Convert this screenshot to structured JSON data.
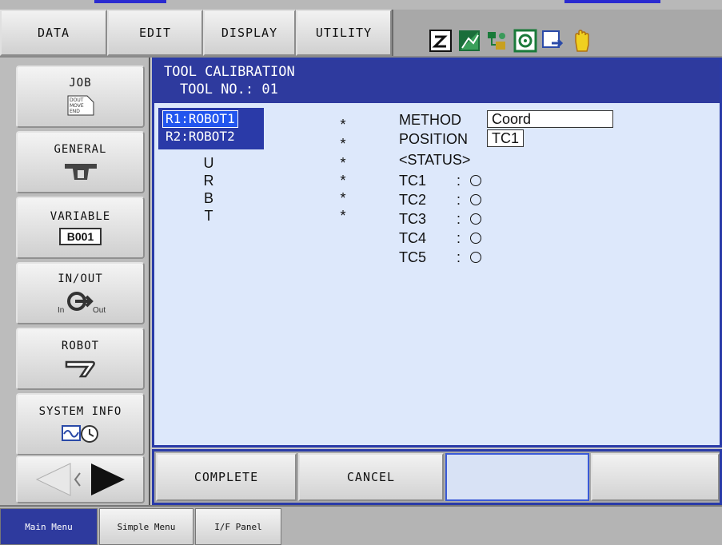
{
  "menu": {
    "data": "DATA",
    "edit": "EDIT",
    "display": "DISPLAY",
    "utility": "UTILITY"
  },
  "status_icons": [
    "mode-icon",
    "signal-icon",
    "network-icon",
    "target-icon",
    "export-icon",
    "hand-icon"
  ],
  "sidebar": {
    "job": "JOB",
    "job_icon_text": [
      "DOUT",
      "MOVE",
      "END"
    ],
    "general": "GENERAL",
    "variable": "VARIABLE",
    "variable_tag": "B001",
    "inout": "IN/OUT",
    "inout_in": "In",
    "inout_out": "Out",
    "robot": "ROBOT",
    "system_info": "SYSTEM INFO"
  },
  "panel": {
    "title": "TOOL CALIBRATION",
    "tool_no": "TOOL NO.: 01",
    "robots": [
      "R1:ROBOT1",
      "R2:ROBOT2"
    ],
    "axes": [
      "U",
      "R",
      "B",
      "T"
    ],
    "stars": [
      "*",
      "*",
      "*",
      "*",
      "*",
      "*"
    ],
    "method_label": "METHOD",
    "method_value": "Coord",
    "position_label": "POSITION",
    "position_value": "TC1",
    "status_label": "<STATUS>",
    "tc": [
      {
        "name": "TC1",
        "colon": ":"
      },
      {
        "name": "TC2",
        "colon": ":"
      },
      {
        "name": "TC3",
        "colon": ":"
      },
      {
        "name": "TC4",
        "colon": ":"
      },
      {
        "name": "TC5",
        "colon": ":"
      }
    ]
  },
  "buttons": {
    "complete": "COMPLETE",
    "cancel": "CANCEL"
  },
  "tabs": {
    "main_menu": "Main Menu",
    "simple_menu": "Simple Menu",
    "if_panel": "I/F Panel"
  },
  "colors": {
    "title_bar": "#2e3a9e",
    "panel_bg": "#dde8fb",
    "selection": "#2255ee"
  }
}
